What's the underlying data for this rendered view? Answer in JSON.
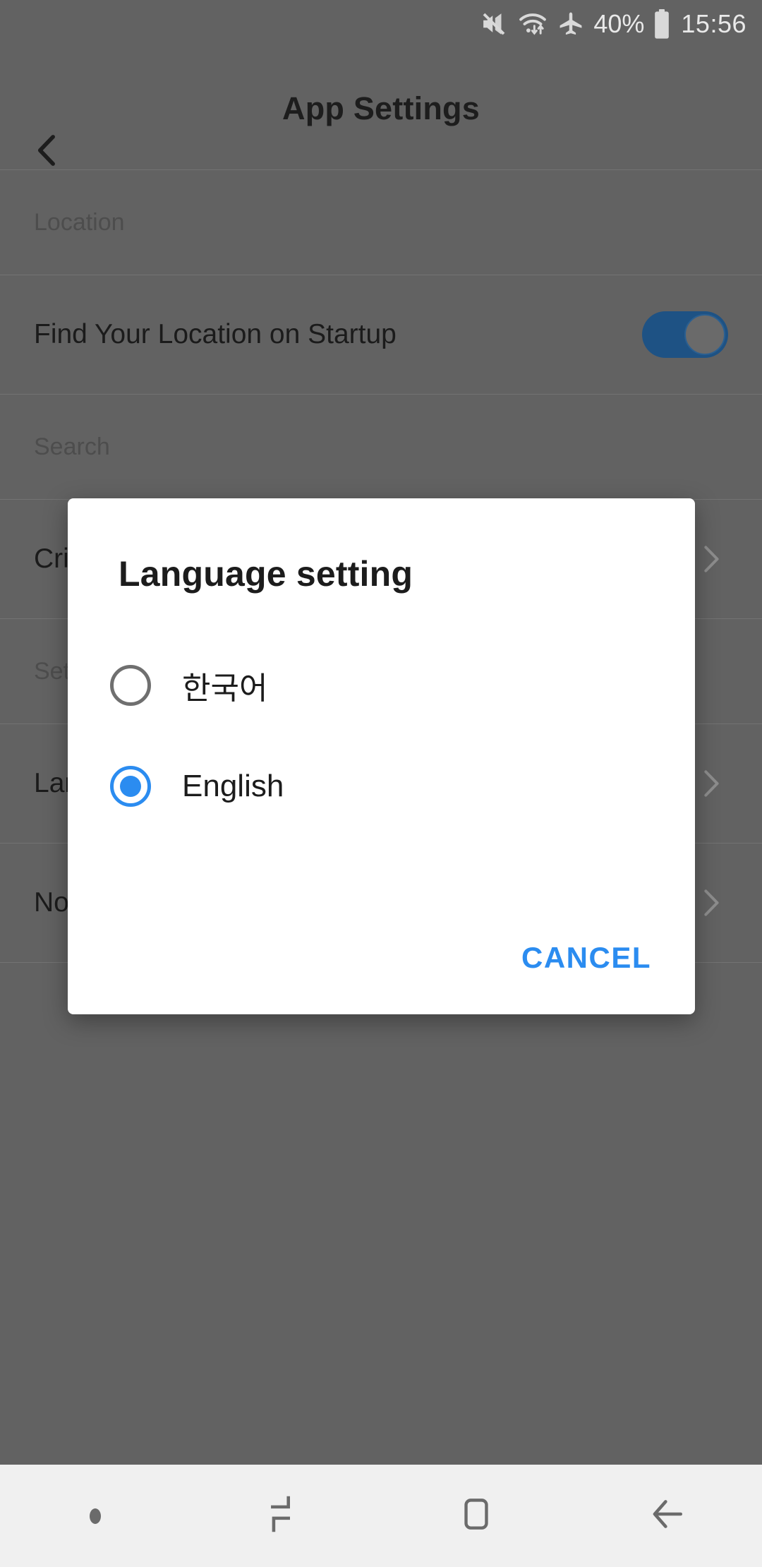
{
  "status_bar": {
    "icons": [
      "mute-icon",
      "wifi-data-icon",
      "airplane-mode-icon",
      "battery-icon"
    ],
    "battery_percent": "40%",
    "time": "15:56"
  },
  "app_bar": {
    "back_icon": "chevron-left-icon",
    "title": "App Settings"
  },
  "settings": {
    "sections": [
      {
        "header": "Location",
        "rows": [
          {
            "label": "Find Your Location on Startup",
            "control": "toggle",
            "toggle_on": true
          }
        ]
      },
      {
        "header": "Search",
        "rows": [
          {
            "label": "Criteria",
            "control": "chevron"
          }
        ]
      },
      {
        "header": "Settings",
        "rows": [
          {
            "label": "Language",
            "control": "chevron"
          },
          {
            "label": "Notification",
            "control": "chevron"
          }
        ]
      }
    ]
  },
  "dialog": {
    "title": "Language setting",
    "options": [
      {
        "label": "한국어",
        "selected": false
      },
      {
        "label": "English",
        "selected": true
      }
    ],
    "cancel_label": "CANCEL",
    "accent_color": "#2b8cf0"
  },
  "nav_bar": {
    "items": [
      "dot-indicator",
      "recents-icon",
      "home-icon",
      "back-icon"
    ]
  },
  "colors": {
    "background": "#626262",
    "dialog_background": "#ffffff",
    "accent": "#2b8cf0",
    "toggle_on": "#1e5284",
    "nav_bar": "#f0f0f0"
  }
}
